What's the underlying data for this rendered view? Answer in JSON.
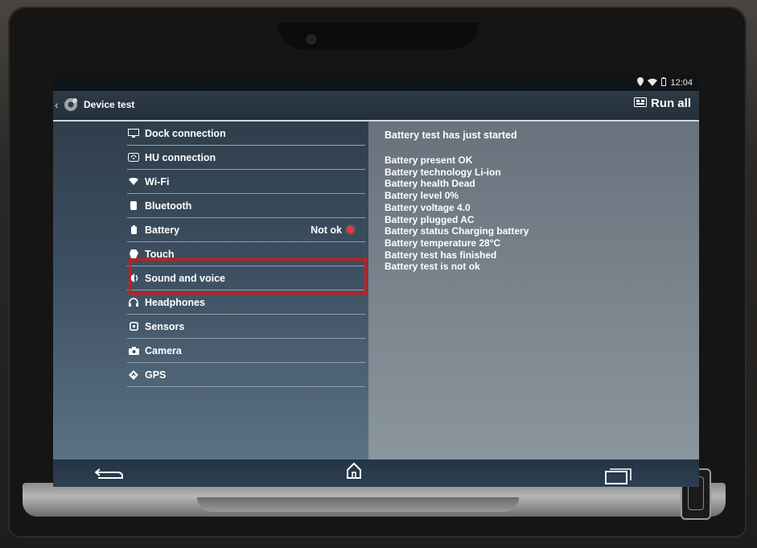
{
  "statusbar": {
    "time": "12:04",
    "icons": [
      "location-icon",
      "wifi-icon",
      "battery-icon"
    ]
  },
  "appbar": {
    "title": "Device test",
    "run_all_label": "Run all",
    "icons": {
      "back": "back-caret-icon",
      "app": "gear-icon",
      "run_all": "run-all-icon"
    }
  },
  "tests": [
    {
      "label": "Dock connection",
      "icon": "dock-icon"
    },
    {
      "label": "HU connection",
      "icon": "hu-connection-icon"
    },
    {
      "label": "Wi-Fi",
      "icon": "wifi-icon"
    },
    {
      "label": "Bluetooth",
      "icon": "bluetooth-icon"
    },
    {
      "label": "Battery",
      "icon": "battery-icon",
      "result": "Not ok",
      "status_color": "#e23b3b"
    },
    {
      "label": "Touch",
      "icon": "touch-icon"
    },
    {
      "label": "Sound and voice",
      "icon": "speaker-icon"
    },
    {
      "label": "Headphones",
      "icon": "headphones-icon"
    },
    {
      "label": "Sensors",
      "icon": "sensors-icon"
    },
    {
      "label": "Camera",
      "icon": "camera-icon"
    },
    {
      "label": "GPS",
      "icon": "gps-icon"
    }
  ],
  "log": {
    "title": "Battery test has just started",
    "lines": [
      "Battery present OK",
      "Battery technology Li-ion",
      "Battery health Dead",
      "Battery level 0%",
      "Battery voltage 4.0",
      "Battery plugged AC",
      "Battery status Charging battery",
      "Battery temperature 28°C",
      "Battery test has finished",
      "Battery test is not ok"
    ]
  },
  "navbar": {
    "icons": [
      "back-icon",
      "home-icon",
      "recent-apps-icon"
    ]
  },
  "colors": {
    "highlight": "#c91c1c",
    "accent": "#cfd6dc"
  }
}
